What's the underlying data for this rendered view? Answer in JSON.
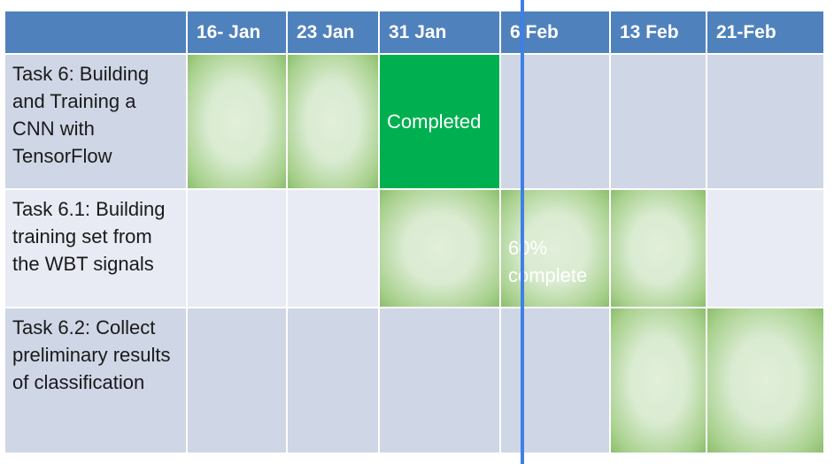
{
  "timeline": {
    "columns": [
      "",
      "16- Jan",
      "23 Jan",
      "31 Jan",
      "6 Feb",
      "13 Feb",
      "21-Feb"
    ],
    "tasks": [
      {
        "name": "Task 6: Building and Training a CNN with TensorFlow",
        "status": "Completed"
      },
      {
        "name": "Task 6.1: Building training set from the WBT signals",
        "status": "60% complete"
      },
      {
        "name": "Task 6.2: Collect preliminary results of classification"
      }
    ]
  },
  "colors": {
    "header": "#4f81bd",
    "row_dark": "#cfd6e5",
    "row_light": "#e8ebf4",
    "completed": "#00b050",
    "in_progress_fill": "#a9d18e",
    "current_date_line": "#3f7fe8"
  }
}
